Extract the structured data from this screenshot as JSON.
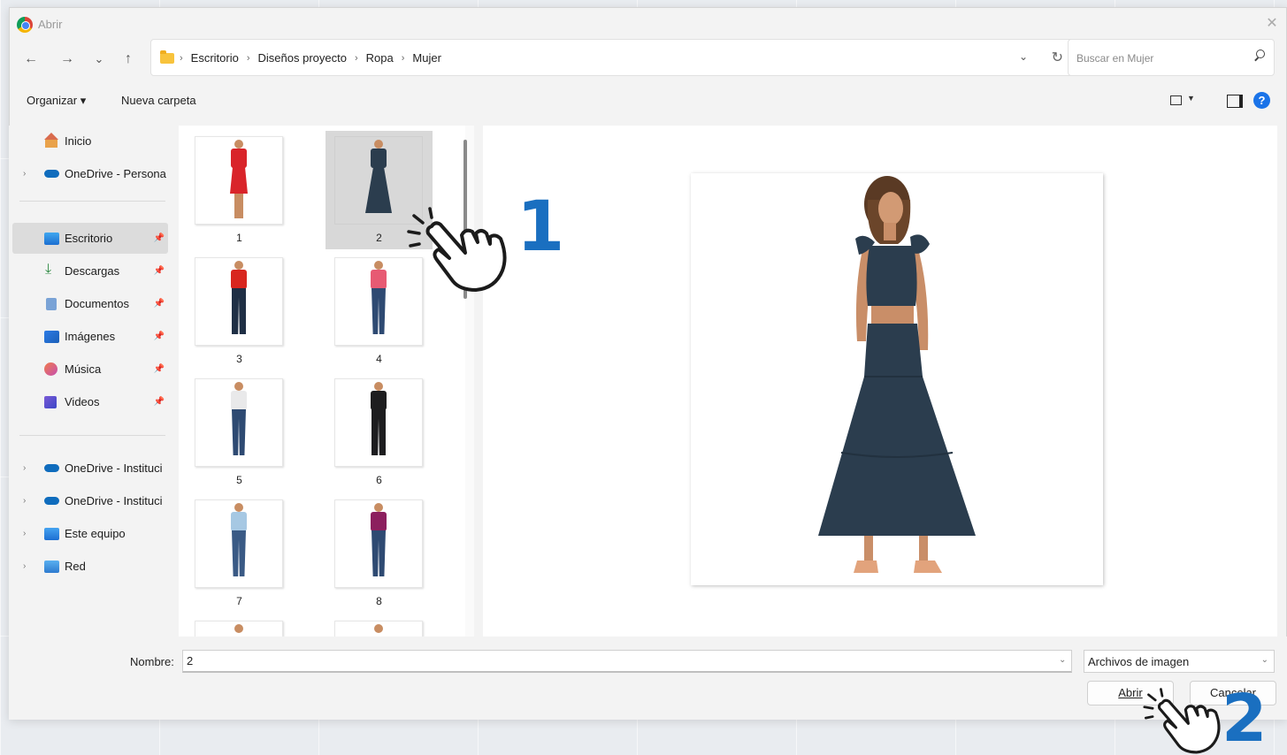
{
  "window": {
    "title": "Abrir",
    "close_symbol": "✕"
  },
  "nav": {
    "back": "←",
    "forward": "→",
    "recent": "⌄",
    "up": "↑"
  },
  "breadcrumbs": [
    "Escritorio",
    "Diseños proyecto",
    "Ropa",
    "Mujer"
  ],
  "search": {
    "placeholder": "Buscar en Mujer"
  },
  "toolbar": {
    "organize": "Organizar ▾",
    "new_folder": "Nueva carpeta",
    "help": "?"
  },
  "sidebar": {
    "top": [
      {
        "label": "Inicio",
        "icon": "home-icon"
      },
      {
        "label": "OneDrive - Persona",
        "icon": "cloud-icon"
      }
    ],
    "quick": [
      {
        "label": "Escritorio",
        "icon": "desktop-icon",
        "selected": true
      },
      {
        "label": "Descargas",
        "icon": "download-icon"
      },
      {
        "label": "Documentos",
        "icon": "document-icon"
      },
      {
        "label": "Imágenes",
        "icon": "pictures-icon"
      },
      {
        "label": "Música",
        "icon": "music-icon"
      },
      {
        "label": "Videos",
        "icon": "video-icon"
      }
    ],
    "bottom": [
      {
        "label": "OneDrive - Instituci",
        "icon": "cloud-icon"
      },
      {
        "label": "OneDrive - Instituci",
        "icon": "cloud-icon"
      },
      {
        "label": "Este equipo",
        "icon": "computer-icon"
      },
      {
        "label": "Red",
        "icon": "network-icon"
      }
    ]
  },
  "files": [
    {
      "label": "1",
      "top_color": "#d9242a",
      "bottom_color": "#d9242a",
      "style": "dress"
    },
    {
      "label": "2",
      "top_color": "#2b3d4e",
      "bottom_color": "#2b3d4e",
      "style": "skirt",
      "selected": true
    },
    {
      "label": "3",
      "top_color": "#d8261f",
      "bottom_color": "#1f2f45",
      "style": "pants"
    },
    {
      "label": "4",
      "top_color": "#e75a73",
      "bottom_color": "#2e4a72",
      "style": "jeans"
    },
    {
      "label": "5",
      "top_color": "#e9e9ea",
      "bottom_color": "#2e4a72",
      "style": "jeans"
    },
    {
      "label": "6",
      "top_color": "#1d1d1f",
      "bottom_color": "#1d1d1f",
      "style": "pants"
    },
    {
      "label": "7",
      "top_color": "#a6c8e3",
      "bottom_color": "#3a5a85",
      "style": "jeans"
    },
    {
      "label": "8",
      "top_color": "#8c1f5e",
      "bottom_color": "#2e4a72",
      "style": "jeans"
    }
  ],
  "footer": {
    "name_label": "Nombre:",
    "name_value": "2",
    "file_type": "Archivos de imagen",
    "open_button": "Abrir",
    "cancel_button": "Cancelar"
  },
  "callouts": {
    "step1": "1",
    "step2": "2"
  },
  "colors": {
    "accent": "#1a6fc0",
    "skirt": "#2b3d4e"
  }
}
